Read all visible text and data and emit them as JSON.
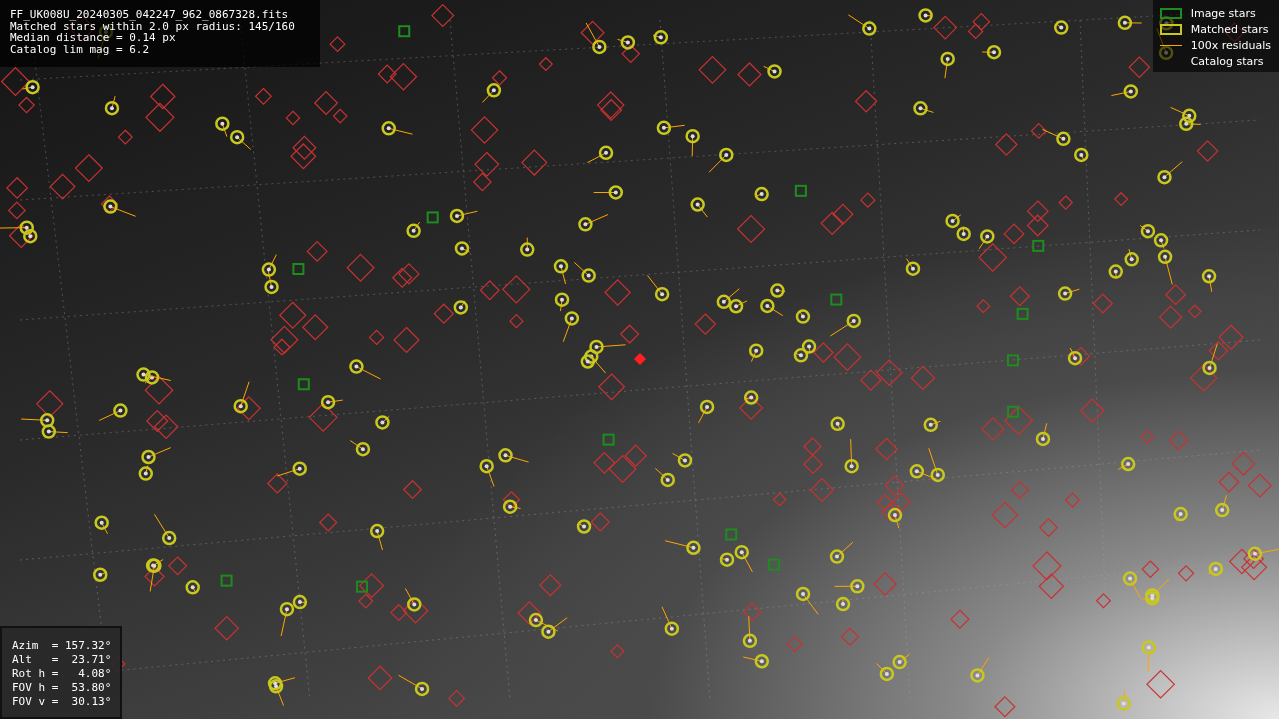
{
  "file_info": {
    "lines": [
      "FF_UK008U_20240305_042247_962_0867328.fits",
      "Matched stars within 2.0 px radius: 145/160",
      "Median distance = 0.14 px",
      "Catalog lim mag = 6.2"
    ]
  },
  "legend": [
    {
      "kind": "box",
      "color": "#1e8c1e",
      "label": "Image stars"
    },
    {
      "kind": "box",
      "color": "#c8c81e",
      "label": "Matched stars"
    },
    {
      "kind": "line",
      "color": "#ffa500",
      "label": "100x residuals"
    },
    {
      "kind": "none",
      "label": "Catalog stars"
    }
  ],
  "pointing": {
    "lines": [
      "Azim  = 157.32°",
      "Alt   =  23.71°",
      "Rot h =   4.08°",
      "FOV h =  53.80°",
      "FOV v =  30.13°"
    ]
  }
}
